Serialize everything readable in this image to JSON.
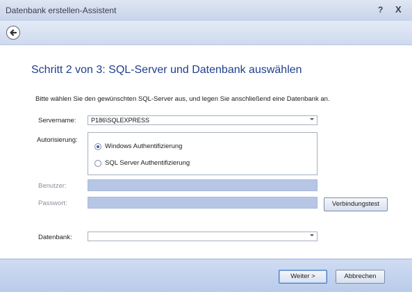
{
  "window": {
    "title": "Datenbank erstellen-Assistent",
    "help_label": "?",
    "close_label": "X"
  },
  "nav": {
    "back_icon": "back-arrow-icon"
  },
  "page": {
    "heading": "Schritt 2 von 3: SQL-Server und Datenbank auswählen",
    "instruction": "Bitte wählen Sie den gewünschten SQL-Server aus, und legen Sie anschließend eine Datenbank an."
  },
  "form": {
    "servername_label": "Servername:",
    "servername_value": "P186\\SQLEXPRESS",
    "auth_label": "Autorisierung:",
    "auth_options": [
      {
        "label": "Windows Authentifizierung",
        "selected": true
      },
      {
        "label": "SQL Server Authentifizierung",
        "selected": false
      }
    ],
    "user_label": "Benutzer:",
    "user_value": "",
    "password_label": "Passwort:",
    "password_value": "",
    "test_button_label": "Verbindungstest",
    "database_label": "Datenbank:",
    "database_value": ""
  },
  "footer": {
    "next_button_label": "Weiter >",
    "cancel_button_label": "Abbrechen"
  },
  "colors": {
    "heading": "#1f3f8c",
    "disabled_input": "#b7c6e5",
    "footer": "#c5d5ef",
    "titlebar": "#d3ddef"
  }
}
